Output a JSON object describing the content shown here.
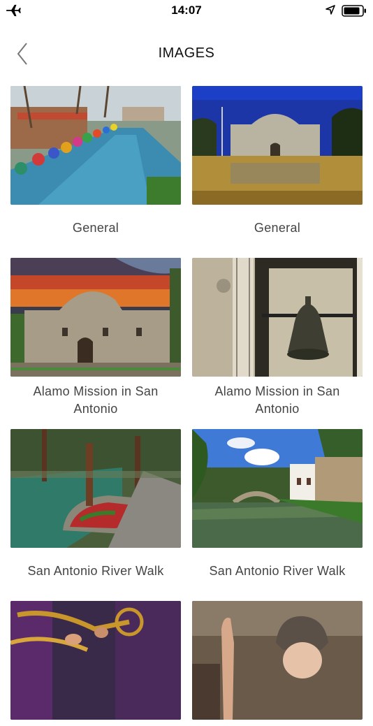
{
  "status": {
    "time": "14:07"
  },
  "header": {
    "title": "IMAGES"
  },
  "items": [
    {
      "caption": "General"
    },
    {
      "caption": "General"
    },
    {
      "caption": "Alamo Mission in San Antonio"
    },
    {
      "caption": "Alamo Mission in San Antonio"
    },
    {
      "caption": "San Antonio River Walk"
    },
    {
      "caption": "San Antonio River Walk"
    },
    {
      "caption": ""
    },
    {
      "caption": ""
    }
  ]
}
